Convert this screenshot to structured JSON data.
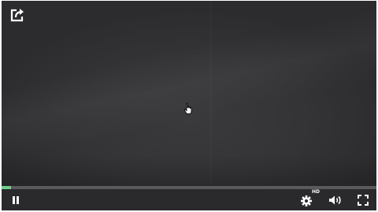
{
  "player": {
    "state": "paused-indicator-shows-pause",
    "progress_fraction": 0.025,
    "accent_color": "#6fcf8e",
    "background_color": "#2f2f31"
  },
  "controls": {
    "share_icon": "share-icon",
    "pause_icon": "pause-icon",
    "settings_icon": "gear-icon",
    "hd_badge": "HD",
    "volume_icon": "volume-icon",
    "fullscreen_icon": "fullscreen-icon"
  },
  "cursor": {
    "icon": "hand-pointer-icon"
  }
}
